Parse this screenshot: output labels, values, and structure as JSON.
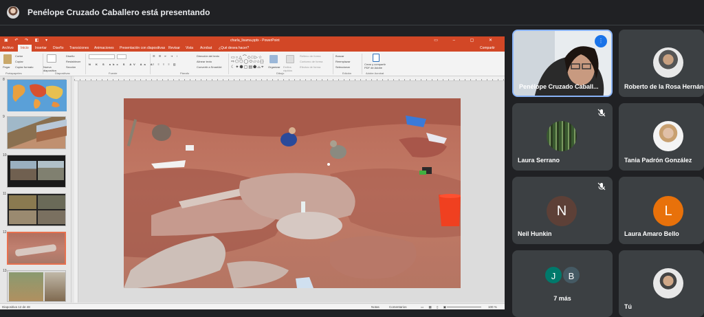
{
  "meet": {
    "presenting": "Penélope Cruzado Caballero está presentando"
  },
  "ppt": {
    "file_title": "charla_lisama.pptx - PowerPoint",
    "tabs": [
      "Archivo",
      "Inicio",
      "Insertar",
      "Diseño",
      "Transiciones",
      "Animaciones",
      "Presentación con diapositivas",
      "Revisar",
      "Vista",
      "Acrobat"
    ],
    "tell_me": "¿Qué desea hacer?",
    "share": "Compartir",
    "ribbon": {
      "portapapeles": "Portapapeles",
      "pegar": "Pegar",
      "cortar": "Cortar",
      "copiar": "Copiar",
      "copiar_formato": "Copiar formato",
      "nueva_diapositiva": "Nueva diapositiva",
      "diseno": "Diseño",
      "restablecer": "Restablecer",
      "seccion": "Sección",
      "diapositivas": "Diapositivas",
      "fuente": "Fuente",
      "parrafo": "Párrafo",
      "direccion_texto": "Dirección del texto",
      "alinear_texto": "Alinear texto",
      "convertir_smartart": "Convertir a SmartArt",
      "dibujo": "Dibujo",
      "organizar": "Organizar",
      "estilos_rapidos": "Estilos rápidos",
      "relleno_forma": "Relleno de forma",
      "contorno_forma": "Contorno de forma",
      "efectos_forma": "Efectos de forma",
      "buscar": "Buscar",
      "reemplazar": "Reemplazar",
      "seleccionar": "Seleccionar",
      "edicion": "Edición",
      "crear_pdf": "Crear y compartir PDF de Adobe",
      "adobe_acrobat": "Adobe Acrobat"
    },
    "slide_numbers": [
      "8",
      "9",
      "10",
      "11",
      "12",
      "13"
    ],
    "status": {
      "slide_info": "Diapositiva 12 de 48",
      "notas": "Notas",
      "comentarios": "Comentarios",
      "zoom": "100 %"
    }
  },
  "participants": [
    {
      "name": "Penélope Cruzado Caball...",
      "type": "video"
    },
    {
      "name": "Roberto de la Rosa Hernández",
      "type": "photo"
    },
    {
      "name": "Laura Serrano",
      "type": "photo",
      "muted": true
    },
    {
      "name": "Tania Padrón González",
      "type": "photo"
    },
    {
      "name": "Neil Hunkin",
      "letter": "N",
      "color": "#5d4037",
      "muted": true
    },
    {
      "name": "Laura Amaro Bello",
      "letter": "L",
      "color": "#e8710a"
    },
    {
      "name": "7 más",
      "letters": [
        "J",
        "B"
      ],
      "colors": [
        "#00796b",
        "#455a64"
      ]
    },
    {
      "name": "Tú",
      "type": "photo"
    }
  ],
  "colors": {
    "accent_blue": "#8ab4f8",
    "ppt_red": "#d24726",
    "tile_bg": "#3c4043"
  }
}
